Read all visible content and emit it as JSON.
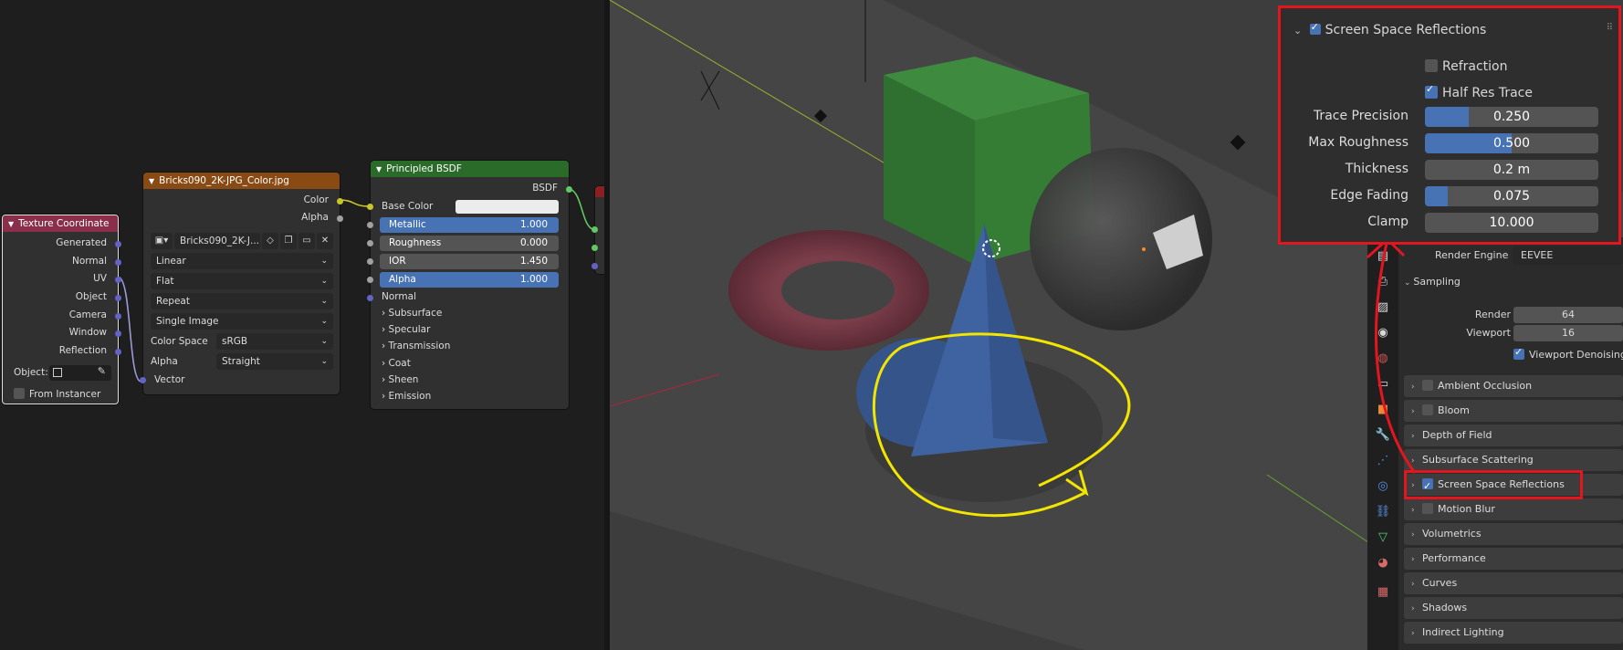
{
  "node_editor": {
    "texture_coordinate": {
      "title": "Texture Coordinate",
      "outputs": [
        "Generated",
        "Normal",
        "UV",
        "Object",
        "Camera",
        "Window",
        "Reflection"
      ],
      "object_label": "Object:",
      "from_instancer_label": "From Instancer"
    },
    "image_texture": {
      "title": "Bricks090_2K-JPG_Color.jpg",
      "outputs": [
        "Color",
        "Alpha"
      ],
      "image_name": "Bricks090_2K-J...",
      "interpolation": "Linear",
      "projection": "Flat",
      "extension": "Repeat",
      "source": "Single Image",
      "color_space_label": "Color Space",
      "color_space_value": "sRGB",
      "alpha_label": "Alpha",
      "alpha_value": "Straight",
      "input_vector": "Vector"
    },
    "principled": {
      "title": "Principled BSDF",
      "output": "BSDF",
      "base_color_label": "Base Color",
      "fields": [
        {
          "label": "Metallic",
          "value": "1.000",
          "style": "blue"
        },
        {
          "label": "Roughness",
          "value": "0.000",
          "style": "dark"
        },
        {
          "label": "IOR",
          "value": "1.450",
          "style": "dark"
        },
        {
          "label": "Alpha",
          "value": "1.000",
          "style": "blue"
        }
      ],
      "normal_label": "Normal",
      "sections": [
        "Subsurface",
        "Specular",
        "Transmission",
        "Coat",
        "Sheen",
        "Emission"
      ]
    }
  },
  "popover": {
    "title": "Screen Space Reflections",
    "refraction_label": "Refraction",
    "half_res_label": "Half Res Trace",
    "rows": [
      {
        "label": "Trace Precision",
        "value": "0.250",
        "fill": 0.25
      },
      {
        "label": "Max Roughness",
        "value": "0.500",
        "fill": 0.5
      },
      {
        "label": "Thickness",
        "value": "0.2 m",
        "fill": 0
      },
      {
        "label": "Edge Fading",
        "value": "0.075",
        "fill": 0.13
      },
      {
        "label": "Clamp",
        "value": "10.000",
        "fill": 0
      }
    ]
  },
  "properties": {
    "render_engine_label": "Render Engine",
    "render_engine_value": "EEVEE",
    "sampling_label": "Sampling",
    "render_label": "Render",
    "render_value": "64",
    "viewport_label": "Viewport",
    "viewport_value": "16",
    "viewport_denoising_label": "Viewport Denoising",
    "panels": [
      {
        "label": "Ambient Occlusion",
        "checkbox": true,
        "checked": false
      },
      {
        "label": "Bloom",
        "checkbox": true,
        "checked": false
      },
      {
        "label": "Depth of Field",
        "checkbox": false,
        "checked": false
      },
      {
        "label": "Subsurface Scattering",
        "checkbox": false,
        "checked": false
      },
      {
        "label": "Screen Space Reflections",
        "checkbox": true,
        "checked": true
      },
      {
        "label": "Motion Blur",
        "checkbox": true,
        "checked": false
      },
      {
        "label": "Volumetrics",
        "checkbox": false,
        "checked": false
      },
      {
        "label": "Performance",
        "checkbox": false,
        "checked": false
      },
      {
        "label": "Curves",
        "checkbox": false,
        "checked": false
      },
      {
        "label": "Shadows",
        "checkbox": false,
        "checked": false
      },
      {
        "label": "Indirect Lighting",
        "checkbox": false,
        "checked": false
      }
    ]
  },
  "colors": {
    "accent_blue": "#4772b3",
    "annotation_red": "#e3161f",
    "annotation_yellow": "#f2e600",
    "node_tex_coord_header": "#8a2e4a",
    "node_image_header": "#8a4a14",
    "node_shader_header": "#2a6b2a"
  }
}
